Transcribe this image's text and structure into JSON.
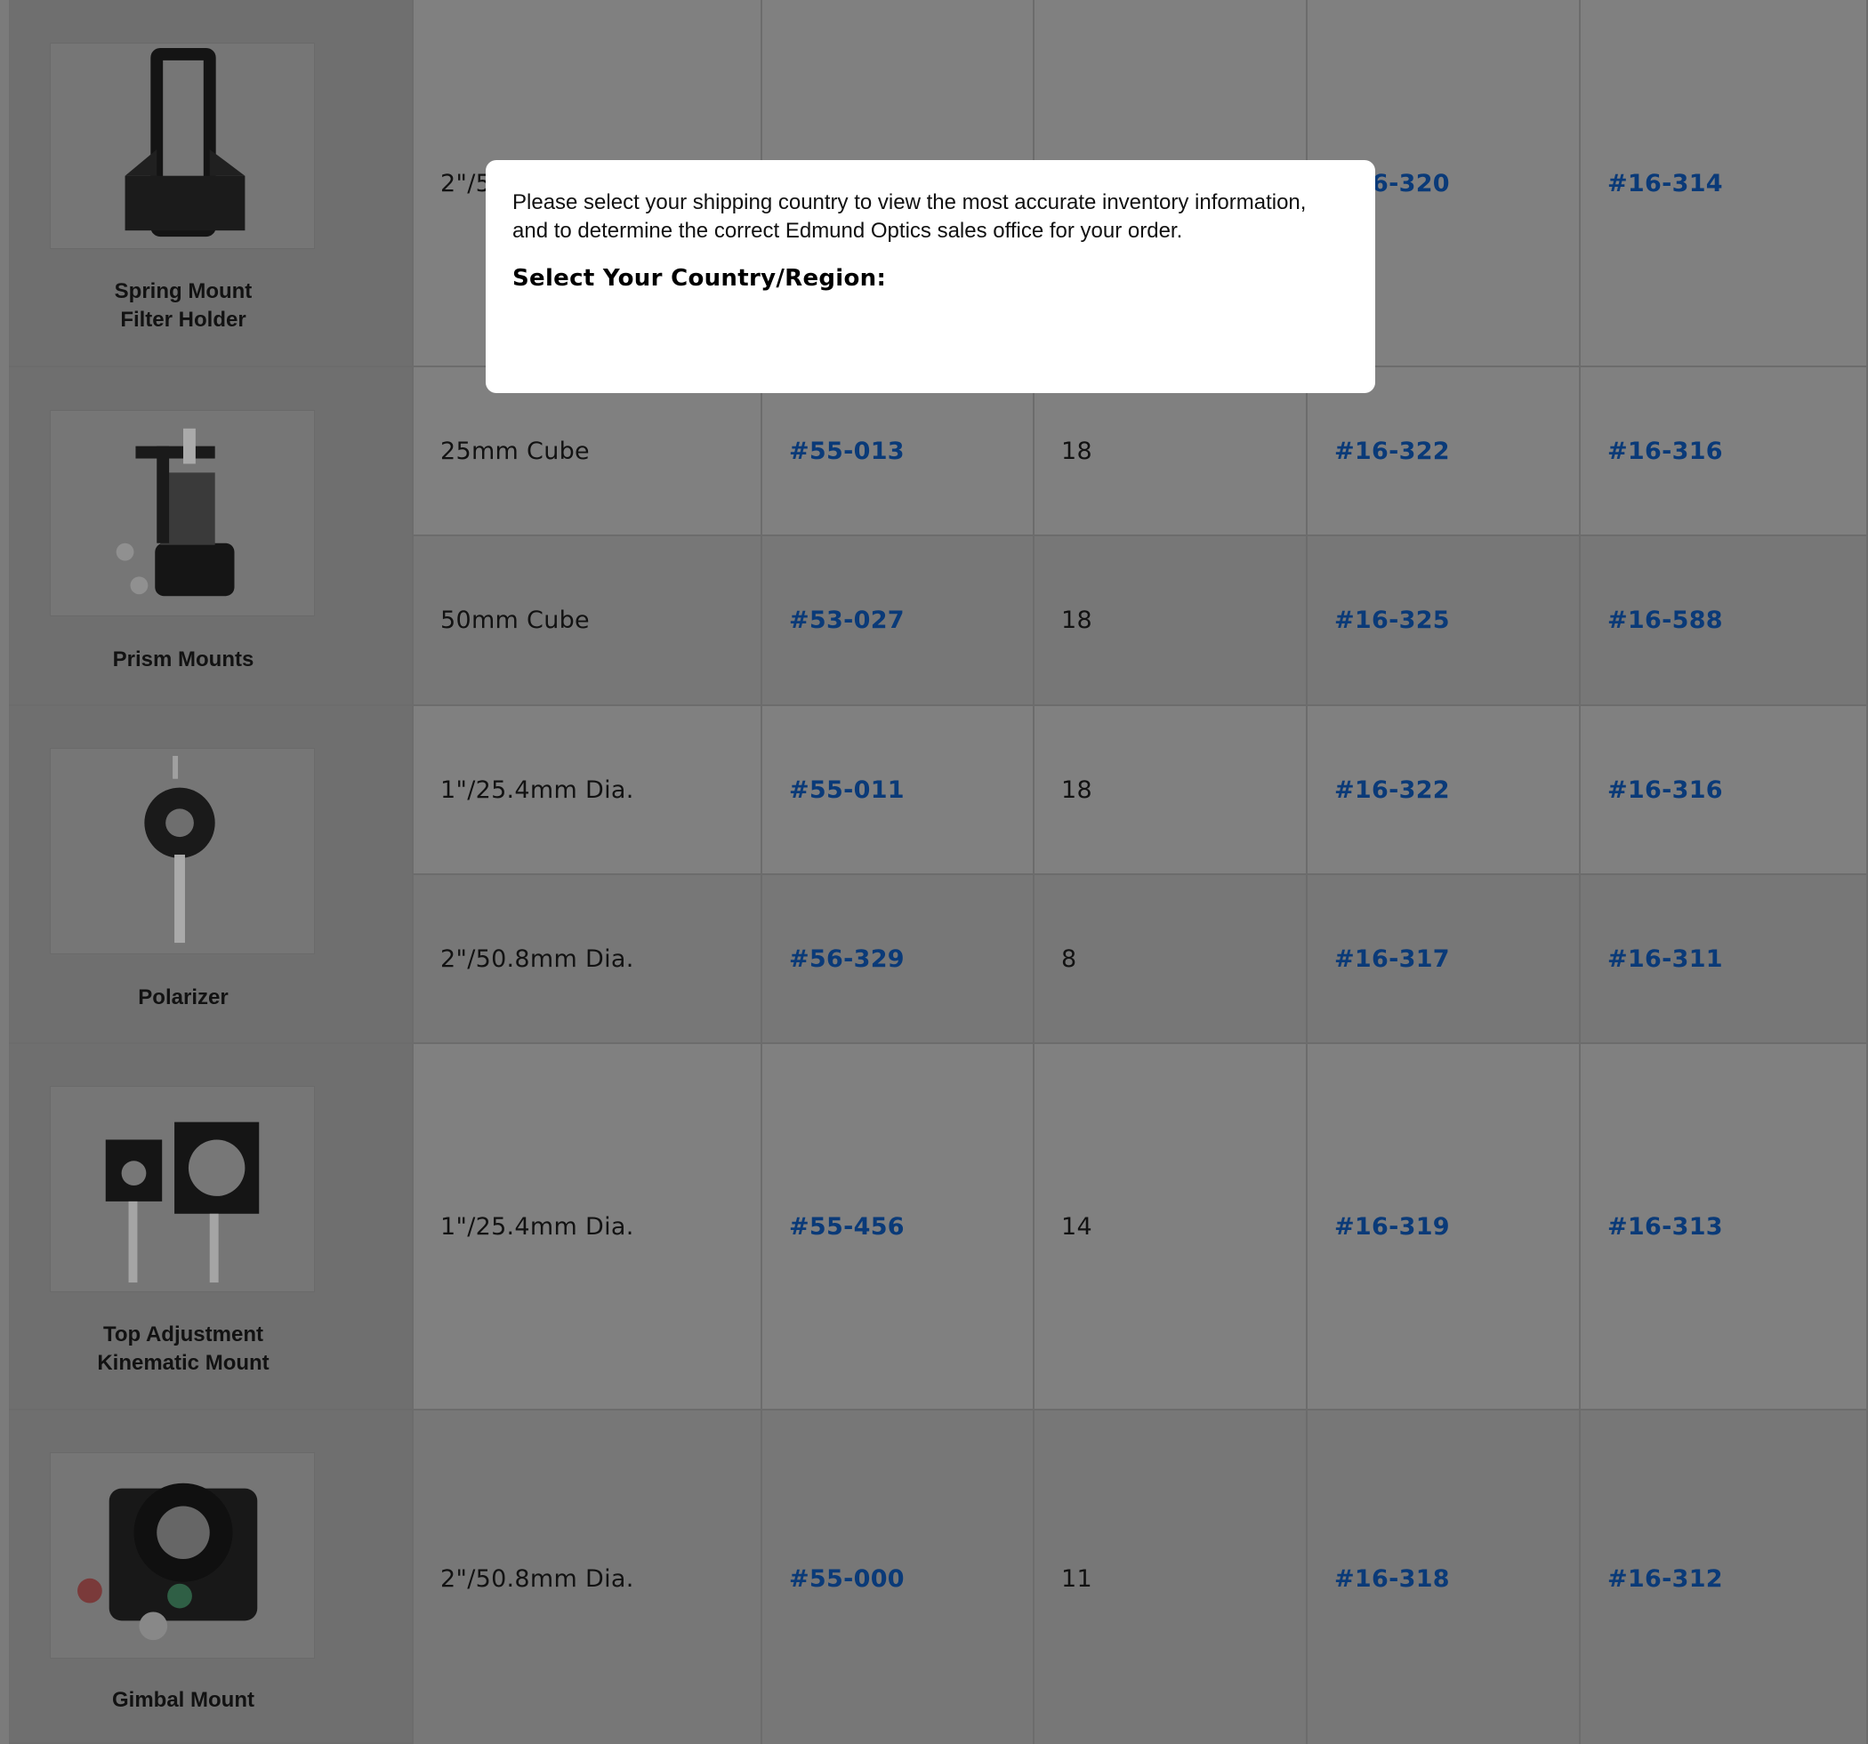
{
  "products": [
    {
      "name_lines": [
        "Spring Mount",
        "Filter Holder"
      ],
      "icon": "spring-mount-filter-holder-image",
      "rows": [
        {
          "size": "2\"/5",
          "stock": "#",
          "qty": "",
          "p1": "#16-320",
          "p2": "#16-314",
          "p1_visible": "-320"
        }
      ]
    },
    {
      "name_lines": [
        "Prism Mounts"
      ],
      "icon": "prism-mount-image",
      "rows": [
        {
          "size": "25mm Cube",
          "stock": "#55-013",
          "qty": "18",
          "p1": "#16-322",
          "p2": "#16-316"
        },
        {
          "size": "50mm Cube",
          "stock": "#53-027",
          "qty": "18",
          "p1": "#16-325",
          "p2": "#16-588"
        }
      ]
    },
    {
      "name_lines": [
        "Polarizer"
      ],
      "icon": "polarizer-mount-image",
      "rows": [
        {
          "size": "1\"/25.4mm Dia.",
          "stock": "#55-011",
          "qty": "18",
          "p1": "#16-322",
          "p2": "#16-316"
        },
        {
          "size": "2\"/50.8mm Dia.",
          "stock": "#56-329",
          "qty": "8",
          "p1": "#16-317",
          "p2": "#16-311"
        }
      ]
    },
    {
      "name_lines": [
        "Top Adjustment",
        "Kinematic Mount"
      ],
      "icon": "kinematic-mount-image",
      "rows": [
        {
          "size": "1\"/25.4mm Dia.",
          "stock": "#55-456",
          "qty": "14",
          "p1": "#16-319",
          "p2": "#16-313"
        }
      ]
    },
    {
      "name_lines": [
        "Gimbal Mount"
      ],
      "icon": "gimbal-mount-image",
      "rows": [
        {
          "size": "2\"/50.8mm Dia.",
          "stock": "#55-000",
          "qty": "11",
          "p1": "#16-318",
          "p2": "#16-312"
        }
      ]
    }
  ],
  "modal": {
    "message_line1": "Please select your shipping country to view the most accurate inventory information,",
    "message_line2": "and to determine the correct Edmund Optics sales office for your order.",
    "heading": "Select Your Country/Region:"
  },
  "colors": {
    "link": "#0a3a78",
    "overlay_gray": "#7b7b7b",
    "modal_bg": "#ffffff"
  }
}
